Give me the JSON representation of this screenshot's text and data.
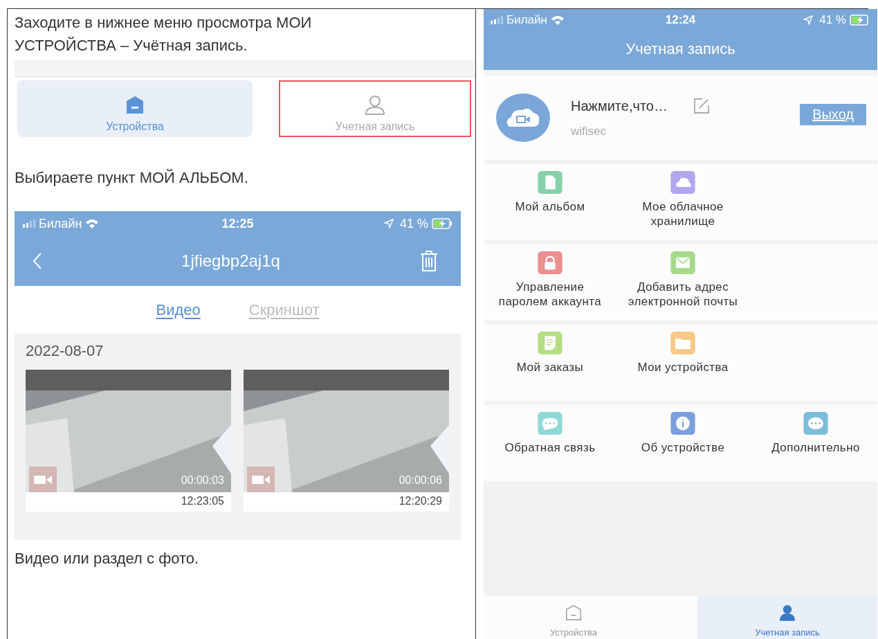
{
  "left": {
    "intro": "Заходите в нижнее меню просмотра МОИ УСТРОЙСТВА – Учётная запись.",
    "tab_bar": [
      {
        "label": "Устройства",
        "selected": true,
        "highlighted": false,
        "kind": "devices"
      },
      {
        "label": "Учетная запись",
        "selected": false,
        "highlighted": true,
        "kind": "account"
      }
    ],
    "step_2": "Выбираете пункт МОЙ АЛЬБОМ.",
    "album_screen": {
      "status_bar": {
        "carrier": "Билайн",
        "time": "12:25",
        "battery": "41 %"
      },
      "title": "1jfiegbp2aj1q",
      "tabs": [
        {
          "label": "Видео",
          "selected": true
        },
        {
          "label": "Скриншот",
          "selected": false
        }
      ],
      "date": "2022-08-07",
      "videos": [
        {
          "duration": "00:00:03",
          "time": "12:23:05"
        },
        {
          "duration": "00:00:06",
          "time": "12:20:29"
        }
      ]
    },
    "step_3": "Видео или раздел с фото."
  },
  "account_screen": {
    "status_bar": {
      "carrier": "Билайн",
      "time": "12:24",
      "battery": "41 %"
    },
    "title": "Учетная запись",
    "profile": {
      "name": "Нажмите,что…",
      "account": "wifisec",
      "logout": "Выход"
    },
    "menu_rows": [
      [
        {
          "label": "Мой альбом",
          "color": "#86d1a8",
          "kind": "file"
        },
        {
          "label": "Мое облачное\nхранилище",
          "color": "#b3a6ee",
          "kind": "cloud"
        }
      ],
      [
        {
          "label": "Управление\nпаролем аккаунта",
          "color": "#ea8e8e",
          "kind": "lock"
        },
        {
          "label": "Добавить адрес\nэлектронной почты",
          "color": "#a6d98a",
          "kind": "mail"
        }
      ],
      [
        {
          "label": "Мой заказы",
          "color": "#b4dd84",
          "kind": "note"
        },
        {
          "label": "Мои устройства",
          "color": "#f6c98a",
          "kind": "folder"
        }
      ],
      [
        {
          "label": "Обратная связь",
          "color": "#8fd8d6",
          "kind": "chat"
        },
        {
          "label": "Об устройстве",
          "color": "#7a9fdc",
          "kind": "info"
        },
        {
          "label": "Дополнительно",
          "color": "#7fbcdc",
          "kind": "more"
        }
      ]
    ],
    "bottom_tabs": [
      {
        "label": "Устройства",
        "selected": false,
        "kind": "devices"
      },
      {
        "label": "Учетная запись",
        "selected": true,
        "kind": "account"
      }
    ]
  }
}
